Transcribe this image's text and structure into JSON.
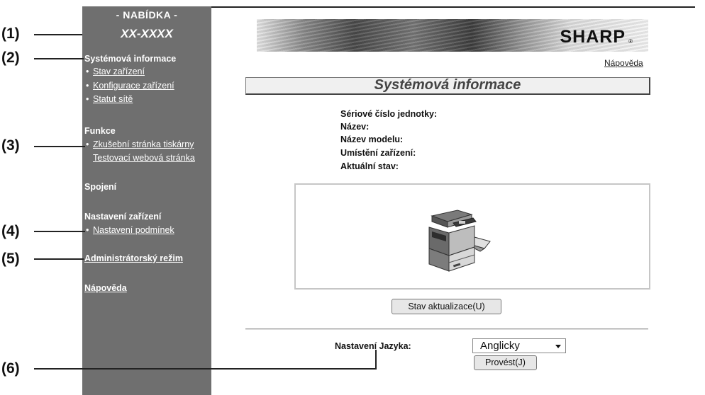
{
  "sidebar": {
    "title": "- NABÍDKA -",
    "model": "XX-XXXX",
    "sections": [
      {
        "label": "Systémová informace",
        "items": [
          "Stav zařízení",
          "Konfigurace zařízení",
          "Statut sítě"
        ]
      },
      {
        "label": "Funkce",
        "items": [
          "Zkušební stránka tiskárny",
          "Testovací webová stránka"
        ]
      },
      {
        "label": "Spojení"
      },
      {
        "label": "Nastavení zařízení",
        "items": [
          "Nastavení podmínek"
        ]
      }
    ],
    "admin_link": "Administrátorský režim",
    "help_link": "Nápověda"
  },
  "callouts": [
    "(1)",
    "(2)",
    "(3)",
    "(4)",
    "(5)",
    "(6)"
  ],
  "header": {
    "brand": "SHARP",
    "registered": "®",
    "help_link": "Nápověda"
  },
  "main": {
    "title": "Systémová informace",
    "info_labels": [
      "Sériové číslo jednotky:",
      "Název:",
      "Název modelu:",
      "Umístění zařízení:",
      "Aktuální stav:"
    ],
    "refresh_button": "Stav aktualizace(U)",
    "language": {
      "label": "Nastavení Jazyka:",
      "selected": "Anglicky",
      "apply_button": "Provést(J)"
    }
  }
}
